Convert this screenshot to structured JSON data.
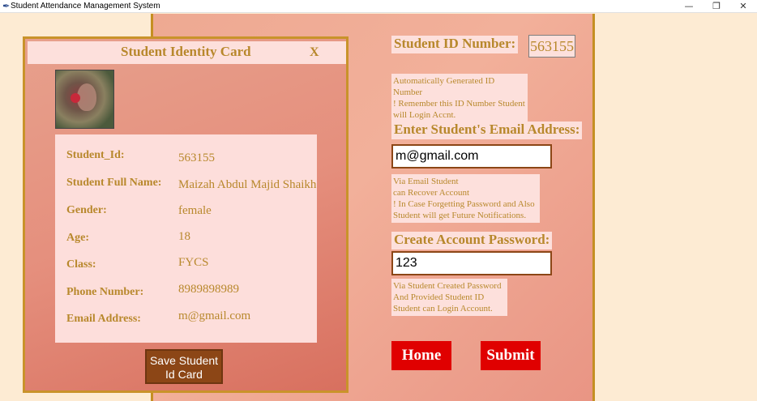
{
  "window": {
    "title": "Student Attendance Management System",
    "minimize": "—",
    "restore": "❐",
    "close": "✕"
  },
  "card": {
    "title": "Student Identity Card",
    "close": "X",
    "fields": [
      {
        "label": "Student_Id:",
        "value": "563155"
      },
      {
        "label": "Student Full Name:",
        "value": "Maizah Abdul Majid Shaikh"
      },
      {
        "label": "Gender:",
        "value": "female"
      },
      {
        "label": "Age:",
        "value": "18"
      },
      {
        "label": "Class:",
        "value": "FYCS"
      },
      {
        "label": "Phone Number:",
        "value": "8989898989"
      },
      {
        "label": "Email Address:",
        "value": "m@gmail.com"
      }
    ],
    "save_button": "Save Student Id Card"
  },
  "form": {
    "id_label": "Student ID Number:",
    "id_value": "563155",
    "id_note": [
      "Automatically Generated ID Number",
      "! Remember this ID Number Student",
      "will Login Accnt."
    ],
    "email_label": "Enter Student's Email Address:",
    "email_value": "m@gmail.com",
    "email_note": [
      "Via Email Student",
      "can Recover Account",
      "! In Case Forgetting Password and Also",
      "Student will get Future Notifications."
    ],
    "password_label": "Create Account Password:",
    "password_value": "123",
    "password_note": [
      "Via Student Created Password",
      "And Provided Student ID",
      "Student can Login Account."
    ],
    "home_button": "Home",
    "submit_button": "Submit"
  },
  "colors": {
    "accent_gold": "#b8882c",
    "border_gold": "#c9932a",
    "button_red": "#e00000",
    "button_brown": "#8c4616"
  }
}
